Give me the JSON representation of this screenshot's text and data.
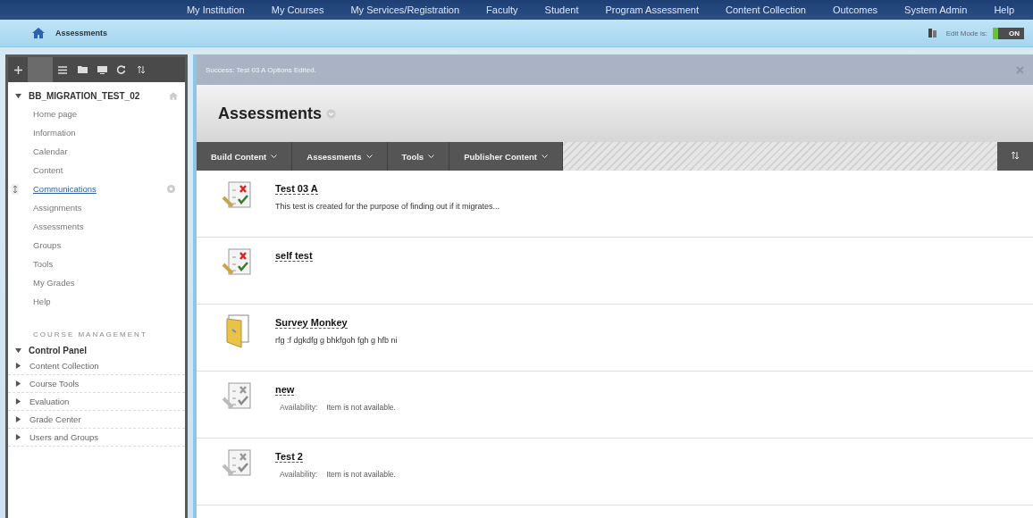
{
  "top_nav": [
    {
      "label": "My Institution"
    },
    {
      "label": "My Courses"
    },
    {
      "label": "My Services/Registration"
    },
    {
      "label": "Faculty"
    },
    {
      "label": "Student"
    },
    {
      "label": "Program Assessment"
    },
    {
      "label": "Content Collection"
    },
    {
      "label": "Outcomes"
    },
    {
      "label": "System Admin"
    },
    {
      "label": "Help"
    }
  ],
  "breadcrumb": {
    "current": "Assessments"
  },
  "edit_mode": {
    "label": "Edit Mode is:",
    "value": "ON",
    "on": true
  },
  "sidebar": {
    "course_title": "BB_MIGRATION_TEST_02",
    "items": [
      {
        "label": "Home page",
        "selected": false
      },
      {
        "label": "Information",
        "selected": false
      },
      {
        "label": "Calendar",
        "selected": false
      },
      {
        "label": "Content",
        "selected": false
      },
      {
        "label": "Communications",
        "selected": true
      },
      {
        "label": "Assignments",
        "selected": false
      },
      {
        "label": "Assessments",
        "selected": false
      },
      {
        "label": "Groups",
        "selected": false
      },
      {
        "label": "Tools",
        "selected": false
      },
      {
        "label": "My Grades",
        "selected": false
      },
      {
        "label": "Help",
        "selected": false
      }
    ],
    "management_heading": "COURSE MANAGEMENT",
    "control_panel": {
      "label": "Control Panel",
      "expanded": true,
      "children": [
        {
          "label": "Content Collection",
          "expanded": false
        },
        {
          "label": "Course Tools",
          "expanded": false
        },
        {
          "label": "Evaluation",
          "expanded": false
        },
        {
          "label": "Grade Center",
          "expanded": false
        },
        {
          "label": "Users and Groups",
          "expanded": false
        }
      ]
    }
  },
  "success_message": "Success: Test 03 A Options Edited.",
  "page_title": "Assessments",
  "action_bar": [
    {
      "label": "Build Content"
    },
    {
      "label": "Assessments"
    },
    {
      "label": "Tools"
    },
    {
      "label": "Publisher Content"
    }
  ],
  "content_items": [
    {
      "kind": "test",
      "title": "Test 03 A",
      "description": "This test is created for the purpose of finding out if it migrates..."
    },
    {
      "kind": "test",
      "title": "self test"
    },
    {
      "kind": "survey",
      "title": "Survey Monkey",
      "description": "rfg :f dgkdfg g bhkfgoh fgh g hfb ni"
    },
    {
      "kind": "test_unavailable",
      "title": "new",
      "availability_label": "Availability:",
      "availability": "Item is not available."
    },
    {
      "kind": "test_unavailable",
      "title": "Test 2",
      "availability_label": "Availability:",
      "availability": "Item is not available."
    }
  ]
}
